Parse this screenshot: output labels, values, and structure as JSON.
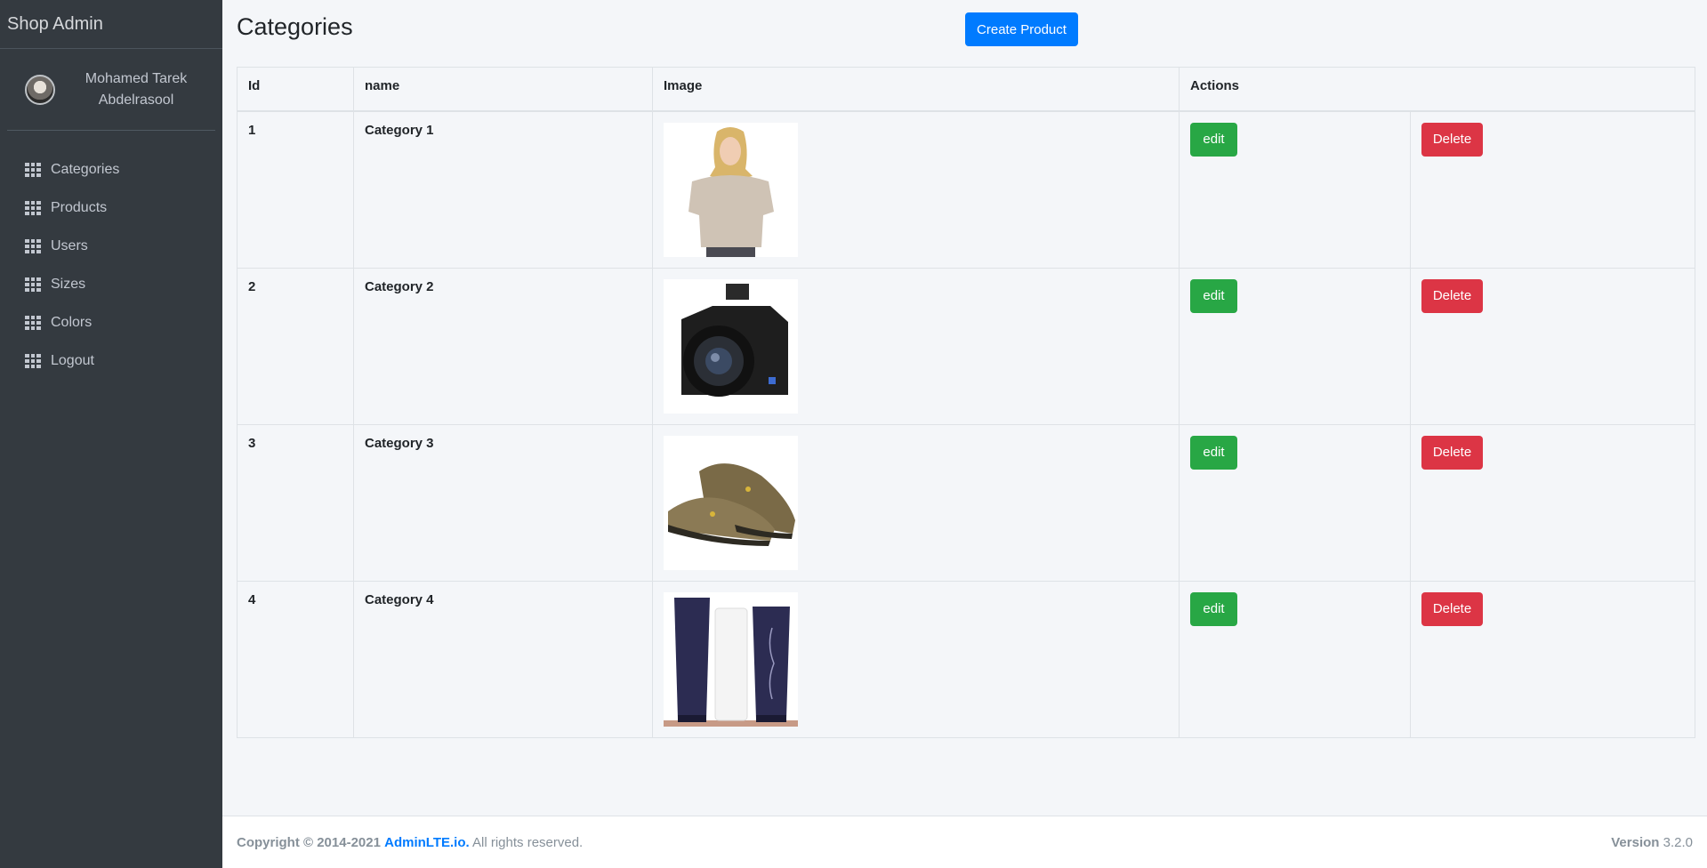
{
  "sidebar": {
    "brand": "Shop Admin",
    "user_name": "Mohamed Tarek Abdelrasool",
    "items": [
      {
        "label": "Categories",
        "icon": "grid-icon"
      },
      {
        "label": "Products",
        "icon": "grid-icon"
      },
      {
        "label": "Users",
        "icon": "grid-icon"
      },
      {
        "label": "Sizes",
        "icon": "grid-icon"
      },
      {
        "label": "Colors",
        "icon": "grid-icon"
      },
      {
        "label": "Logout",
        "icon": "grid-icon"
      }
    ]
  },
  "header": {
    "title": "Categories",
    "create_label": "Create Product"
  },
  "table": {
    "columns": [
      "Id",
      "name",
      "Image",
      "Actions"
    ],
    "edit_label": "edit",
    "delete_label": "Delete",
    "rows": [
      {
        "id": "1",
        "name": "Category 1",
        "image": "sweater-woman-photo"
      },
      {
        "id": "2",
        "name": "Category 2",
        "image": "camera-photo"
      },
      {
        "id": "3",
        "name": "Category 3",
        "image": "shoes-photo"
      },
      {
        "id": "4",
        "name": "Category 4",
        "image": "skincare-tubes-photo"
      }
    ]
  },
  "footer": {
    "copyright": "Copyright © 2014-2021",
    "link": "AdminLTE.io.",
    "rights": "All rights reserved.",
    "version_label": "Version",
    "version": "3.2.0"
  },
  "colors": {
    "sidebar_bg": "#343a40",
    "primary": "#007bff",
    "success": "#28a745",
    "danger": "#dc3545",
    "content_bg": "#f4f6f9"
  }
}
